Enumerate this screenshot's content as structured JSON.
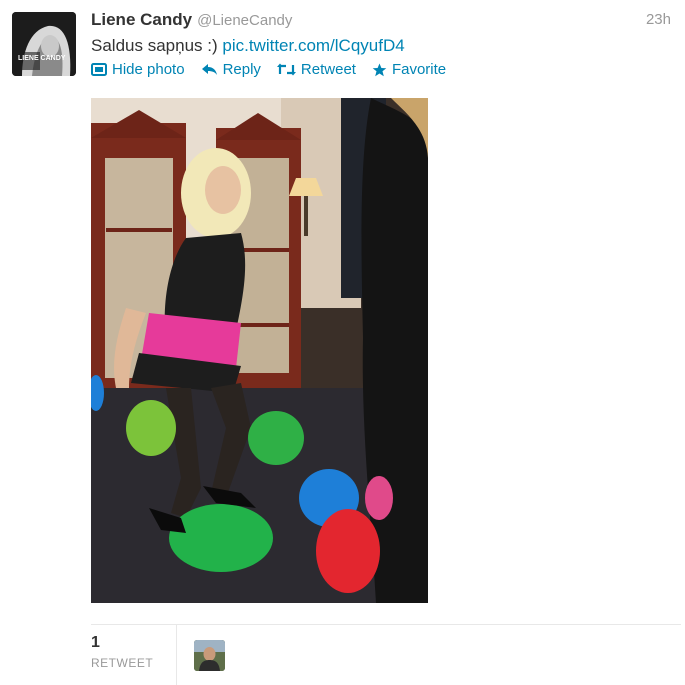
{
  "tweet": {
    "display_name": "Liene Candy",
    "handle": "@LieneCandy",
    "timestamp": "23h",
    "text": "Saldus sapņus :) ",
    "link": "pic.twitter.com/lCqyufD4",
    "avatar_text": "LIENE CANDY"
  },
  "actions": {
    "hide_photo": "Hide photo",
    "reply": "Reply",
    "retweet": "Retweet",
    "favorite": "Favorite"
  },
  "stats": {
    "retweet_count": "1",
    "retweet_label": "RETWEET"
  },
  "colors": {
    "link": "#0084b4",
    "muted": "#999999",
    "text": "#333333"
  }
}
